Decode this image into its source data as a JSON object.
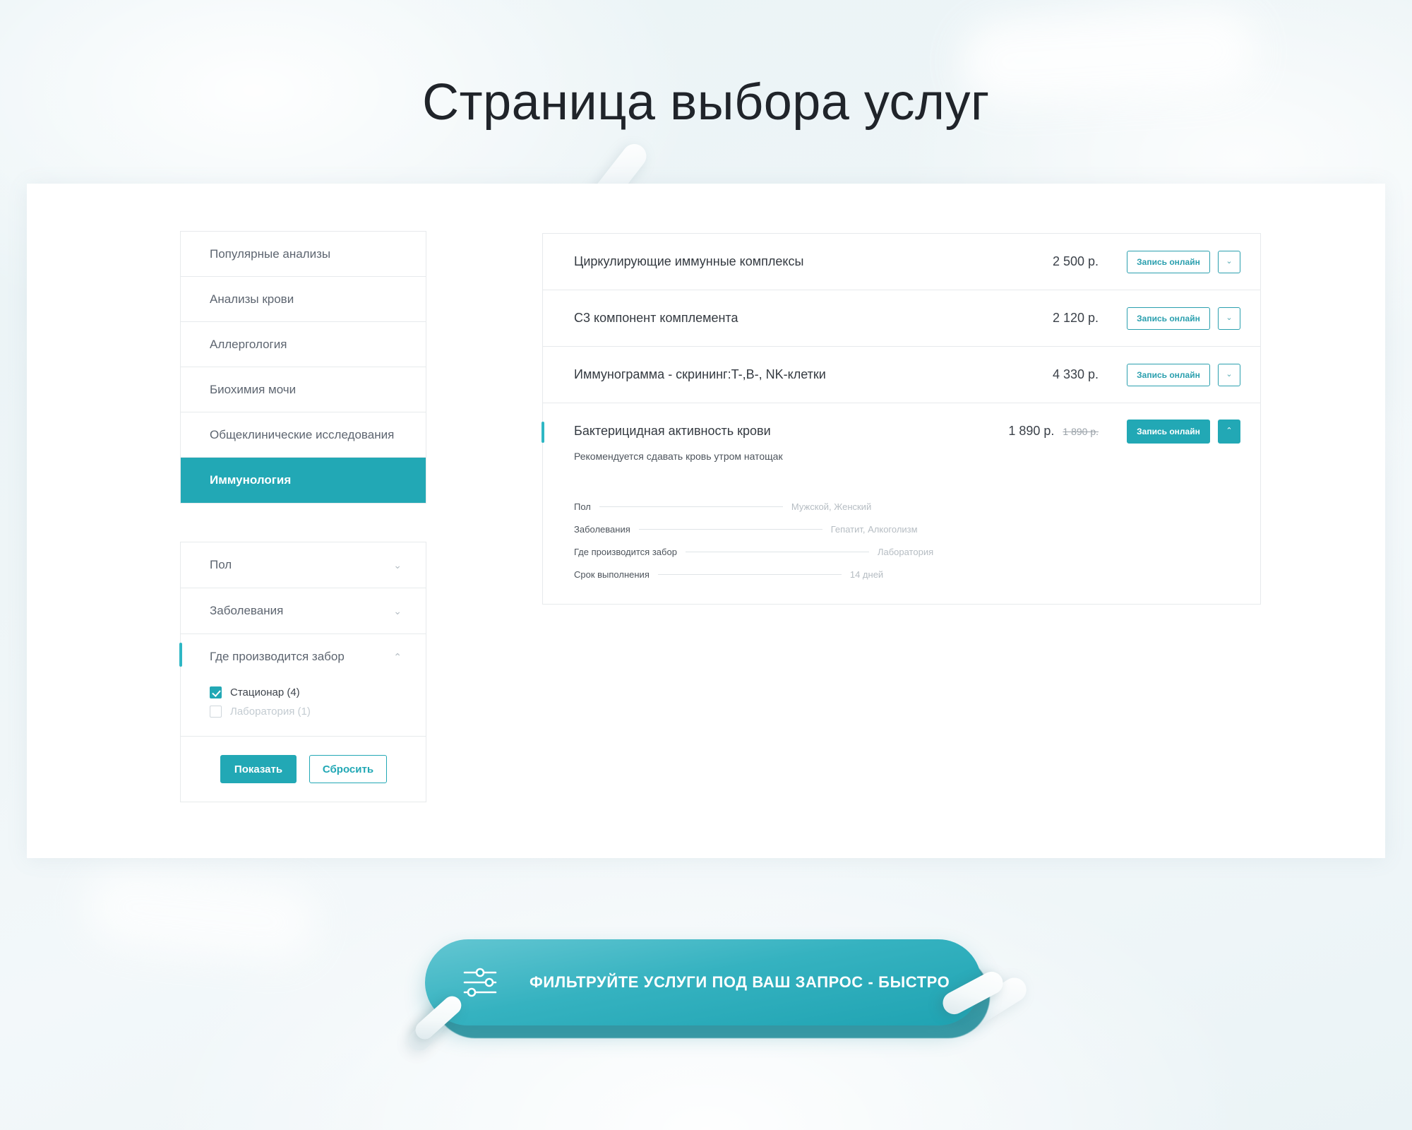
{
  "page": {
    "title": "Страница выбора услуг"
  },
  "sidebar": {
    "categories": [
      {
        "label": "Популярные анализы",
        "active": false
      },
      {
        "label": "Анализы крови",
        "active": false
      },
      {
        "label": "Аллергология",
        "active": false
      },
      {
        "label": "Биохимия мочи",
        "active": false
      },
      {
        "label": "Общеклинические исследования",
        "active": false
      },
      {
        "label": "Иммунология",
        "active": true
      }
    ],
    "filters": [
      {
        "label": "Пол",
        "expanded": false,
        "chevron": "⌄",
        "options": []
      },
      {
        "label": "Заболевания",
        "expanded": false,
        "chevron": "⌄",
        "options": []
      },
      {
        "label": "Где производится забор",
        "expanded": true,
        "chevron": "⌃",
        "options": [
          {
            "label": "Стационар (4)",
            "checked": true,
            "disabled": false
          },
          {
            "label": "Лаборатория (1)",
            "checked": false,
            "disabled": true
          }
        ]
      }
    ],
    "actions": {
      "show_label": "Показать",
      "reset_label": "Сбросить"
    }
  },
  "services": {
    "book_label": "Запись онлайн",
    "chevron_down": "⌄",
    "chevron_up": "⌃",
    "rows": [
      {
        "name": "Циркулирующие иммунные комплексы",
        "price": "2 500 р.",
        "old_price": "",
        "expanded": false
      },
      {
        "name": "C3 компонент комплемента",
        "price": "2 120 р.",
        "old_price": "",
        "expanded": false
      },
      {
        "name": "Иммунограмма - скрининг:T-,B-, NK-клетки",
        "price": "4 330 р.",
        "old_price": "",
        "expanded": false
      },
      {
        "name": "Бактерицидная активность крови",
        "price": "1 890 р.",
        "old_price": "1 890 р.",
        "expanded": true,
        "note": "Рекомендуется сдавать кровь утром натощак",
        "specs": [
          {
            "label": "Пол",
            "value": "Мужской, Женский"
          },
          {
            "label": "Заболевания",
            "value": "Гепатит, Алкоголизм"
          },
          {
            "label": "Где производится забор",
            "value": "Лаборатория"
          },
          {
            "label": "Срок выполнения",
            "value": "14 дней"
          }
        ]
      }
    ]
  },
  "cta": {
    "label": "ФИЛЬТРУЙТЕ УСЛУГИ ПОД ВАШ ЗАПРОС - БЫСТРО",
    "icon": "sliders-icon"
  },
  "colors": {
    "accent": "#22a8b5",
    "accent_light": "#2fb7c4",
    "page_bg": "#eef4f7",
    "card_bg": "#ffffff",
    "border": "#e7eaec",
    "text": "#343a41",
    "muted": "#b6bdc3"
  }
}
